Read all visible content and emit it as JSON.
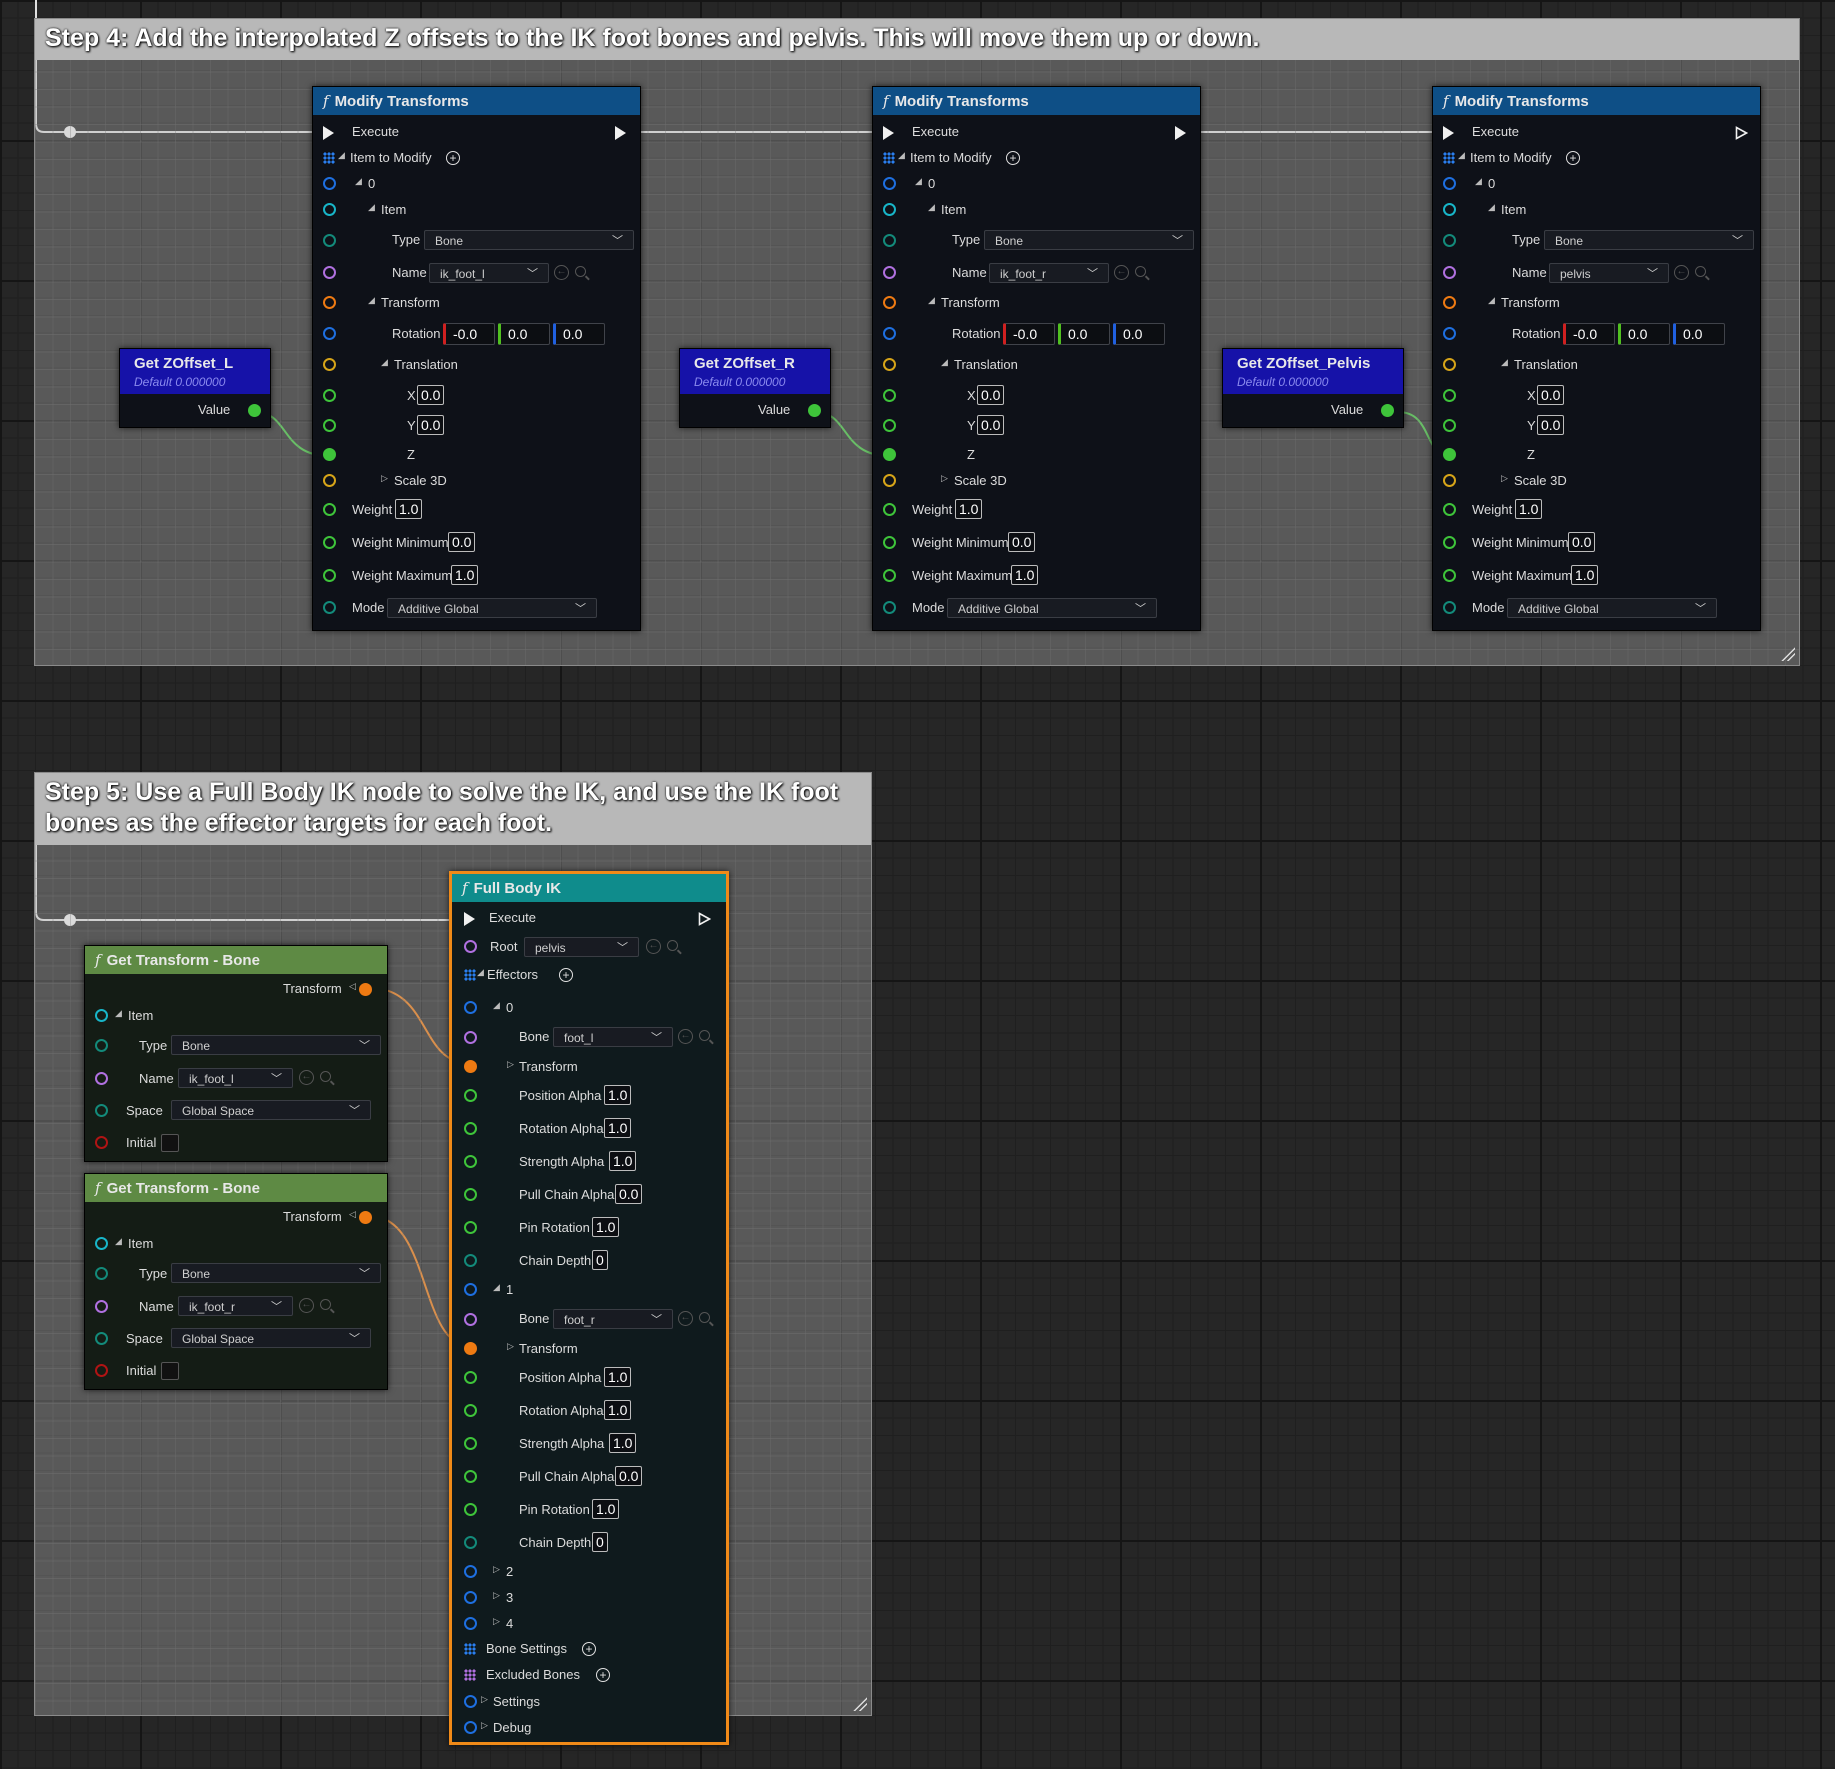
{
  "comments": {
    "step4": "Step 4: Add the interpolated Z offsets to the IK foot bones and pelvis. This will move them up or down.",
    "step5": "Step 5: Use a Full Body IK node to solve the IK, and use the IK foot bones as the effector targets for each foot."
  },
  "modify_nodes": [
    {
      "title": "Modify Transforms",
      "execute": "Execute",
      "item_to_modify": "Item to Modify",
      "index": "0",
      "item": "Item",
      "type_label": "Type",
      "type_value": "Bone",
      "name_label": "Name",
      "name_value": "ik_foot_l",
      "transform": "Transform",
      "rotation_label": "Rotation",
      "rot_x": "-0.0",
      "rot_y": "0.0",
      "rot_z": "0.0",
      "translation": "Translation",
      "x_label": "X",
      "x_value": "0.0",
      "y_label": "Y",
      "y_value": "0.0",
      "z_label": "Z",
      "scale": "Scale 3D",
      "weight_label": "Weight",
      "weight": "1.0",
      "weight_min_label": "Weight Minimum",
      "weight_min": "0.0",
      "weight_max_label": "Weight Maximum",
      "weight_max": "1.0",
      "mode_label": "Mode",
      "mode_value": "Additive Global"
    },
    {
      "title": "Modify Transforms",
      "execute": "Execute",
      "item_to_modify": "Item to Modify",
      "index": "0",
      "item": "Item",
      "type_label": "Type",
      "type_value": "Bone",
      "name_label": "Name",
      "name_value": "ik_foot_r",
      "transform": "Transform",
      "rotation_label": "Rotation",
      "rot_x": "-0.0",
      "rot_y": "0.0",
      "rot_z": "0.0",
      "translation": "Translation",
      "x_label": "X",
      "x_value": "0.0",
      "y_label": "Y",
      "y_value": "0.0",
      "z_label": "Z",
      "scale": "Scale 3D",
      "weight_label": "Weight",
      "weight": "1.0",
      "weight_min_label": "Weight Minimum",
      "weight_min": "0.0",
      "weight_max_label": "Weight Maximum",
      "weight_max": "1.0",
      "mode_label": "Mode",
      "mode_value": "Additive Global"
    },
    {
      "title": "Modify Transforms",
      "execute": "Execute",
      "item_to_modify": "Item to Modify",
      "index": "0",
      "item": "Item",
      "type_label": "Type",
      "type_value": "Bone",
      "name_label": "Name",
      "name_value": "pelvis",
      "transform": "Transform",
      "rotation_label": "Rotation",
      "rot_x": "-0.0",
      "rot_y": "0.0",
      "rot_z": "0.0",
      "translation": "Translation",
      "x_label": "X",
      "x_value": "0.0",
      "y_label": "Y",
      "y_value": "0.0",
      "z_label": "Z",
      "scale": "Scale 3D",
      "weight_label": "Weight",
      "weight": "1.0",
      "weight_min_label": "Weight Minimum",
      "weight_min": "0.0",
      "weight_max_label": "Weight Maximum",
      "weight_max": "1.0",
      "mode_label": "Mode",
      "mode_value": "Additive Global"
    }
  ],
  "var_nodes": [
    {
      "title": "Get ZOffset_L",
      "default": "Default 0.000000",
      "value_label": "Value"
    },
    {
      "title": "Get ZOffset_R",
      "default": "Default 0.000000",
      "value_label": "Value"
    },
    {
      "title": "Get ZOffset_Pelvis",
      "default": "Default 0.000000",
      "value_label": "Value"
    }
  ],
  "get_transform_nodes": [
    {
      "title": "Get Transform - Bone",
      "transform": "Transform",
      "item": "Item",
      "type_label": "Type",
      "type_value": "Bone",
      "name_label": "Name",
      "name_value": "ik_foot_l",
      "space_label": "Space",
      "space_value": "Global Space",
      "initial": "Initial"
    },
    {
      "title": "Get Transform - Bone",
      "transform": "Transform",
      "item": "Item",
      "type_label": "Type",
      "type_value": "Bone",
      "name_label": "Name",
      "name_value": "ik_foot_r",
      "space_label": "Space",
      "space_value": "Global Space",
      "initial": "Initial"
    }
  ],
  "fbik": {
    "title": "Full Body IK",
    "execute": "Execute",
    "root_label": "Root",
    "root_value": "pelvis",
    "effectors": "Effectors",
    "effector_list": [
      {
        "index": "0",
        "bone_label": "Bone",
        "bone_value": "foot_l",
        "transform": "Transform",
        "pos_alpha_label": "Position Alpha",
        "pos_alpha": "1.0",
        "rot_alpha_label": "Rotation Alpha",
        "rot_alpha": "1.0",
        "str_alpha_label": "Strength Alpha",
        "str_alpha": "1.0",
        "pull_label": "Pull Chain Alpha",
        "pull": "0.0",
        "pin_label": "Pin Rotation",
        "pin": "1.0",
        "depth_label": "Chain Depth",
        "depth": "0"
      },
      {
        "index": "1",
        "bone_label": "Bone",
        "bone_value": "foot_r",
        "transform": "Transform",
        "pos_alpha_label": "Position Alpha",
        "pos_alpha": "1.0",
        "rot_alpha_label": "Rotation Alpha",
        "rot_alpha": "1.0",
        "str_alpha_label": "Strength Alpha",
        "str_alpha": "1.0",
        "pull_label": "Pull Chain Alpha",
        "pull": "0.0",
        "pin_label": "Pin Rotation",
        "pin": "1.0",
        "depth_label": "Chain Depth",
        "depth": "0"
      }
    ],
    "collapsed": [
      "2",
      "3",
      "4"
    ],
    "bone_settings": "Bone Settings",
    "excluded_bones": "Excluded Bones",
    "settings": "Settings",
    "debug": "Debug"
  },
  "colors": {
    "exec": "#f0f0f0",
    "float": "#3ec43a",
    "transform": "#ee7a12",
    "name": "#b070e0",
    "struct": "#18b5c8",
    "node_highlight": "#f08a18"
  }
}
